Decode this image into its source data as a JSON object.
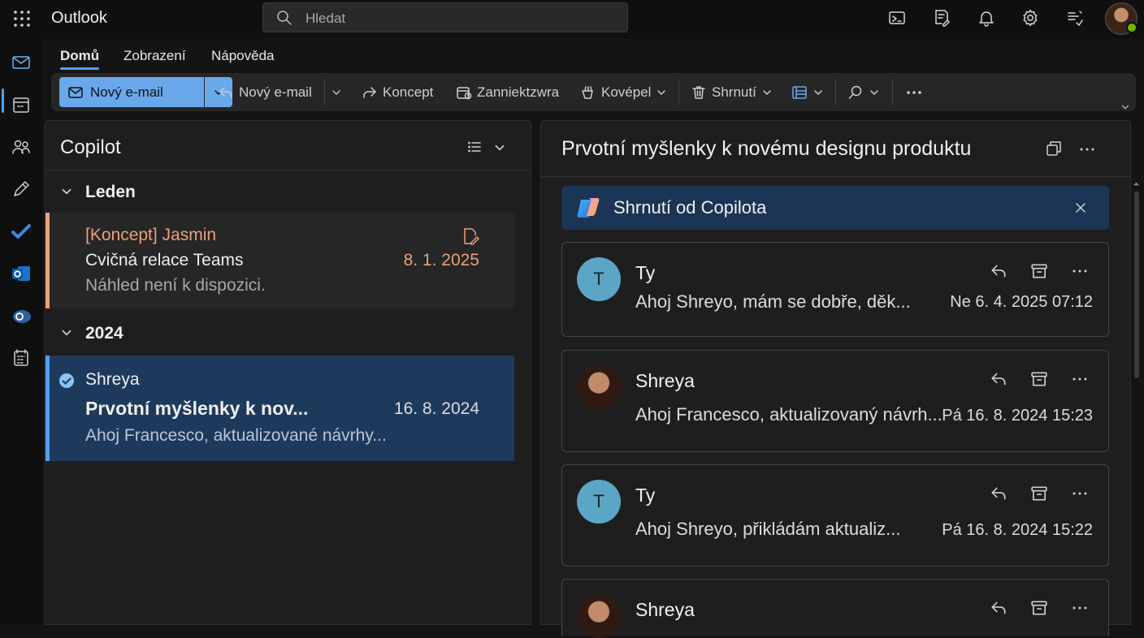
{
  "app": {
    "title": "Outlook"
  },
  "search": {
    "placeholder": "Hledat",
    "value": ""
  },
  "ribbon": {
    "tabs": [
      {
        "label": "Domů",
        "active": true
      },
      {
        "label": "Zobrazení",
        "active": false
      },
      {
        "label": "Nápověda",
        "active": false
      }
    ],
    "toolbar": {
      "new_mail": "Nový e-mail",
      "reply": "Nový e-mail",
      "draft": "Koncept",
      "categorize": "Zanniektzwra",
      "sweep": "Kovépel",
      "summarize": "Shrnutí"
    }
  },
  "list": {
    "title": "Copilot",
    "groups": [
      {
        "label": "Leden"
      },
      {
        "label": "2024"
      }
    ],
    "messages": [
      {
        "sender": "[Koncept] Jasmin",
        "subject": "Cvičná relace Teams",
        "preview": "Náhled není k dispozici.",
        "date": "8. 1. 2025",
        "draft": true
      },
      {
        "sender": "Shreya",
        "subject": "Prvotní myšlenky k nov...",
        "preview": "Ahoj Francesco, aktualizované návrhy...",
        "date": "16. 8. 2024",
        "selected": true
      }
    ]
  },
  "reading": {
    "subject": "Prvotní myšlenky k novému designu produktu",
    "copilot_banner": "Shrnutí od Copilota",
    "thread": [
      {
        "initial": "T",
        "name": "Ty",
        "preview": "Ahoj Shreyo, mám se dobře, děk...",
        "time": "Ne 6. 4. 2025 07:12"
      },
      {
        "initial": "",
        "name": "Shreya",
        "preview": "Ahoj Francesco, aktualizovaný návrh...",
        "time": "Pá 16. 8. 2024 15:23"
      },
      {
        "initial": "T",
        "name": "Ty",
        "preview": "Ahoj Shreyo, přikládám aktualiz...",
        "time": "Pá 16. 8. 2024 15:22"
      },
      {
        "initial": "",
        "name": "Shreya",
        "preview": "",
        "time": ""
      }
    ]
  },
  "colors": {
    "accent": "#4ea3f1",
    "primary_button": "#6aa8ec",
    "draft_text": "#e8a17a",
    "draft_bar": "#e8a17a",
    "selected_bg": "#1d3a5c",
    "copilot_banner_bg": "#1b3556"
  }
}
